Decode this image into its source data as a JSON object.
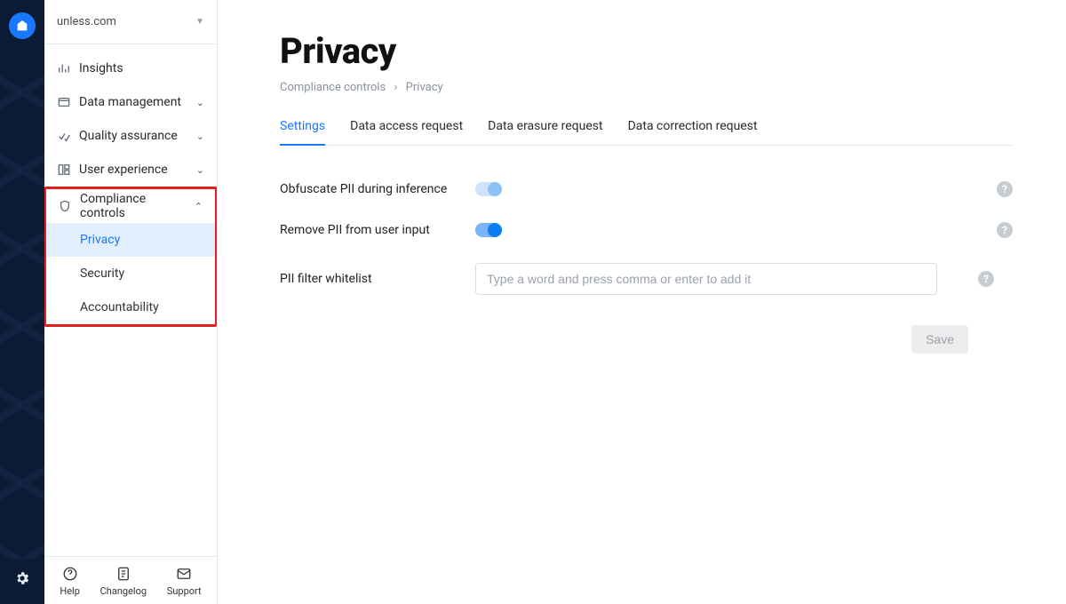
{
  "rail": {
    "logo_name": "brand-logo",
    "gear_name": "settings-icon"
  },
  "sidebar": {
    "domain": "unless.com",
    "items": [
      {
        "label": "Insights",
        "icon": "chart-icon",
        "expandable": false
      },
      {
        "label": "Data management",
        "icon": "folder-icon",
        "expandable": true,
        "expanded": false
      },
      {
        "label": "Quality assurance",
        "icon": "check-icon",
        "expandable": true,
        "expanded": false
      },
      {
        "label": "User experience",
        "icon": "layout-icon",
        "expandable": true,
        "expanded": false
      },
      {
        "label": "Compliance controls",
        "icon": "shield-icon",
        "expandable": true,
        "expanded": true,
        "children": [
          {
            "label": "Privacy",
            "active": true
          },
          {
            "label": "Security",
            "active": false
          },
          {
            "label": "Accountability",
            "active": false
          }
        ]
      }
    ],
    "footer": {
      "help": "Help",
      "changelog": "Changelog",
      "support": "Support"
    }
  },
  "page": {
    "title": "Privacy",
    "breadcrumb": {
      "parent": "Compliance controls",
      "current": "Privacy"
    },
    "tabs": [
      {
        "label": "Settings",
        "active": true
      },
      {
        "label": "Data access request",
        "active": false
      },
      {
        "label": "Data erasure request",
        "active": false
      },
      {
        "label": "Data correction request",
        "active": false
      }
    ],
    "settings": {
      "obfuscate_label": "Obfuscate PII during inference",
      "obfuscate_on": false,
      "remove_label": "Remove PII from user input",
      "remove_on": true,
      "whitelist_label": "PII filter whitelist",
      "whitelist_placeholder": "Type a word and press comma or enter to add it"
    },
    "save_label": "Save"
  }
}
